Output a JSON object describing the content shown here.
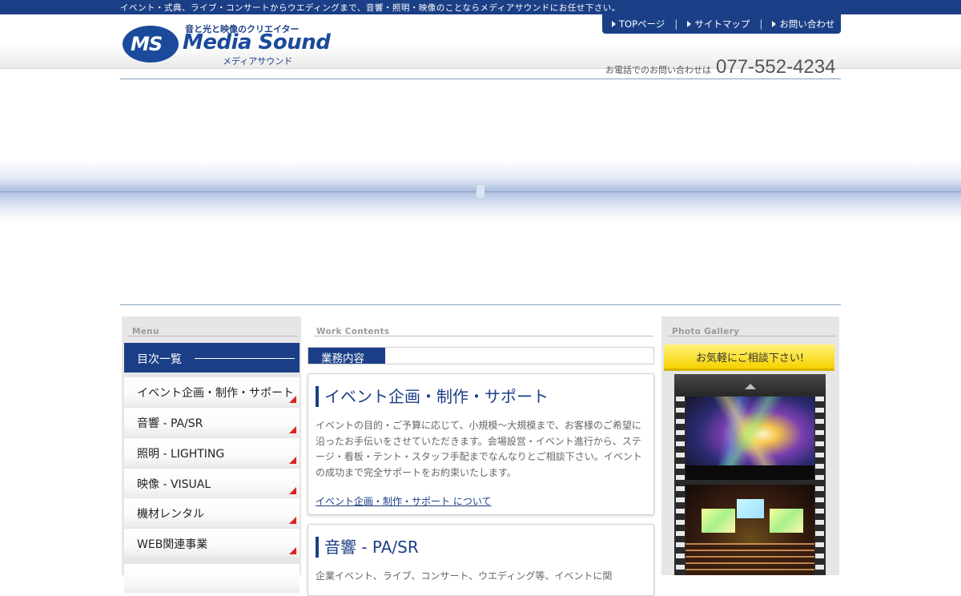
{
  "topbar": {
    "tagline": "イベント・式典、ライブ・コンサートからウエディングまで、音響・照明・映像のことならメディアサウンドにお任せ下さい。"
  },
  "logo": {
    "mark": "MS",
    "tagline": "音と光と映像のクリエイター",
    "name": "Media Sound",
    "kana": "メディアサウンド"
  },
  "topnav": {
    "items": [
      {
        "label": "TOPページ"
      },
      {
        "label": "サイトマップ"
      },
      {
        "label": "お問い合わせ"
      }
    ]
  },
  "phone": {
    "label": "お電話でのお問い合わせは",
    "number": "077-552-4234"
  },
  "sidebar": {
    "title": "Menu",
    "heading": "目次一覧",
    "items": [
      {
        "label": "イベント企画・制作・サポート"
      },
      {
        "label": "音響 - PA/SR"
      },
      {
        "label": "照明 - LIGHTING"
      },
      {
        "label": "映像 - VISUAL"
      },
      {
        "label": "機材レンタル"
      },
      {
        "label": "WEB関連事業"
      }
    ]
  },
  "main": {
    "title": "Work Contents",
    "section_label": "業務内容",
    "cards": [
      {
        "title": "イベント企画・制作・サポート",
        "text": "イベントの目的・ご予算に応じて、小規模〜大規模まで、お客様のご希望に沿ったお手伝いをさせていただきます。会場設営・イベント進行から、ステージ・看板・テント・スタッフ手配までなんなりとご相談下さい。イベントの成功まで完全サポートをお約束いたします。",
        "link": "イベント企画・制作・サポート について"
      },
      {
        "title": "音響 - PA/SR",
        "text": "企業イベント、ライブ、コンサート、ウエディング等、イベントに関"
      }
    ]
  },
  "gallery": {
    "title": "Photo Gallery",
    "banner": "お気軽にご相談下さい!"
  },
  "colors": {
    "brand": "#1b3f86",
    "accent_red": "#e02020",
    "banner_yellow": "#f6d200"
  }
}
